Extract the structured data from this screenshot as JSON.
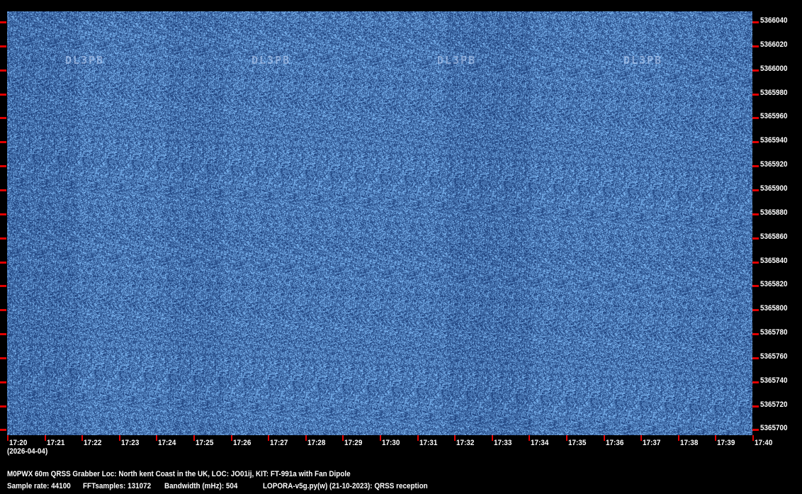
{
  "colors": {
    "background": "#000000",
    "waterfall": "#1c4a8c",
    "tick": "#e00000",
    "text": "#ffffff"
  },
  "signal_label": "DL3PB",
  "frequency_axis": {
    "labels": [
      "5366040",
      "5366020",
      "5366000",
      "5365980",
      "5365960",
      "5365940",
      "5365920",
      "5365900",
      "5365880",
      "5365860",
      "5365840",
      "5365820",
      "5365800",
      "5365780",
      "5365760",
      "5365740",
      "5365720",
      "5365700"
    ]
  },
  "time_axis": {
    "labels": [
      "17:20",
      "17:21",
      "17:22",
      "17:23",
      "17:24",
      "17:25",
      "17:26",
      "17:27",
      "17:28",
      "17:29",
      "17:30",
      "17:31",
      "17:32",
      "17:33",
      "17:34",
      "17:35",
      "17:36",
      "17:37",
      "17:38",
      "17:39",
      "17:40"
    ],
    "date": "(2026-04-04)"
  },
  "info": {
    "line1": "M0PWX 60m QRSS Grabber Loc: North kent Coast in the UK, LOC: JO01ij, KIT: FT-991a with Fan Dipole",
    "sample_rate": "Sample rate: 44100",
    "fft_samples": "FFTsamples: 131072",
    "bandwidth": "Bandwidth (mHz): 504",
    "software": "LOPORA-v5g.py(w) (21-10-2023): QRSS reception"
  }
}
